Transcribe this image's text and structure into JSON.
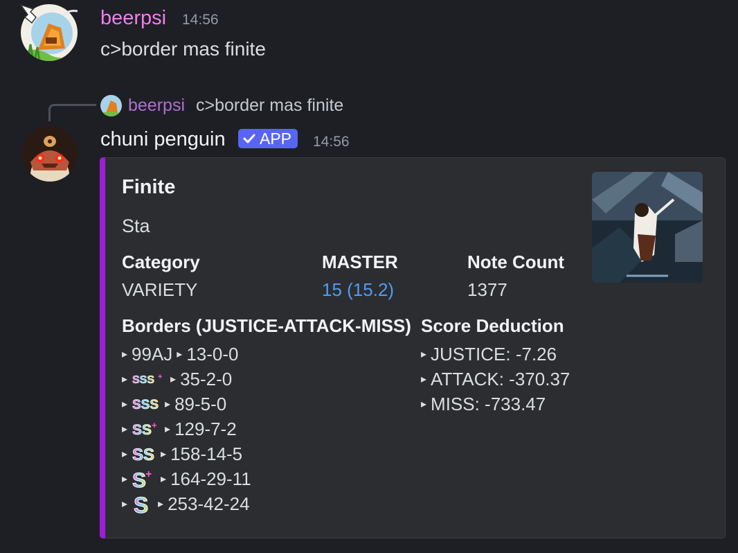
{
  "colors": {
    "accent_bar": "#9b1ed8",
    "name1": "#f07cf2",
    "link": "#4f9df0",
    "badge": "#5865f2"
  },
  "message1": {
    "author": "beerpsi",
    "time": "14:56",
    "content": "c>border mas finite"
  },
  "reply": {
    "author": "beerpsi",
    "content": "c>border mas finite"
  },
  "message2": {
    "author": "chuni penguin",
    "badge": "APP",
    "badge_icon": "checkmark-icon",
    "time": "14:56"
  },
  "embed": {
    "title": "Finite",
    "description": "Sta",
    "fields": [
      {
        "name": "Category",
        "value": "VARIETY"
      },
      {
        "name": "MASTER",
        "value": "15 (15.2)"
      },
      {
        "name": "Note Count",
        "value": "1377"
      }
    ],
    "borders": {
      "name": "Borders (JUSTICE-ATTACK-MISS)",
      "rows": [
        {
          "rank": "99AJ",
          "value": "13-0-0"
        },
        {
          "rank_icon": "sss-plus-icon",
          "value": "35-2-0"
        },
        {
          "rank_icon": "sss-icon",
          "value": "89-5-0"
        },
        {
          "rank_icon": "ss-plus-icon",
          "value": "129-7-2"
        },
        {
          "rank_icon": "ss-icon",
          "value": "158-14-5"
        },
        {
          "rank_icon": "s-plus-icon",
          "value": "164-29-11"
        },
        {
          "rank_icon": "s-icon",
          "value": "253-42-24"
        }
      ]
    },
    "score_deduction": {
      "name": "Score Deduction",
      "rows": [
        "JUSTICE: -7.26",
        "ATTACK: -370.37",
        "MISS: -733.47"
      ]
    }
  }
}
